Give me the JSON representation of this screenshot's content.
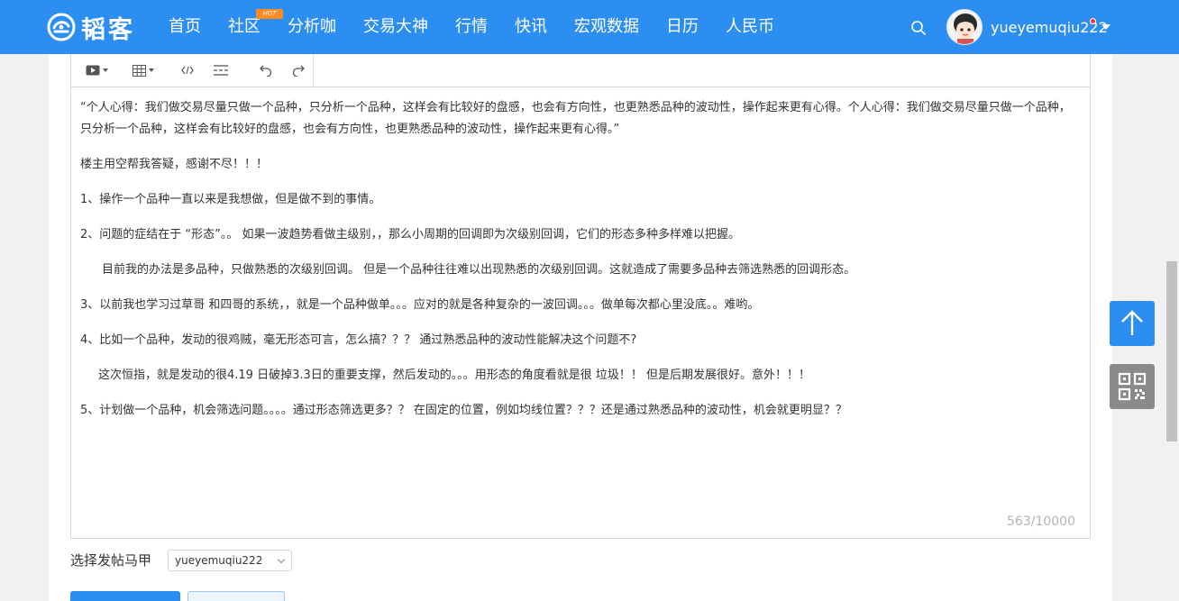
{
  "brand": {
    "name": "韬客"
  },
  "nav": {
    "items": [
      "首页",
      "社区",
      "分析咖",
      "交易大神",
      "行情",
      "快讯",
      "宏观数据",
      "日历",
      "人民币"
    ],
    "hot_badge": "HOT"
  },
  "user": {
    "name": "yueyemuqiu222"
  },
  "icons": {
    "search": "search-icon",
    "caret": "caret-down-icon",
    "back_to_top": "arrow-up-icon",
    "qr": "qr-code-icon"
  },
  "colors": {
    "accent": "#2b8ef0",
    "hot": "#ff8a1f",
    "counter": "#b4b4b4"
  },
  "editor": {
    "toolbar": [
      "video-icon",
      "table-icon",
      "code-icon",
      "divider-icon",
      "undo-icon",
      "redo-icon"
    ],
    "paragraphs": [
      "“个人心得：我们做交易尽量只做一个品种，只分析一个品种，这样会有比较好的盘感，也会有方向性，也更熟悉品种的波动性，操作起来更有心得。个人心得：我们做交易尽量只做一个品种，只分析一个品种，这样会有比较好的盘感，也会有方向性，也更熟悉品种的波动性，操作起来更有心得。”",
      "楼主用空帮我答疑，感谢不尽！！！",
      "1、操作一个品种一直以来是我想做，但是做不到的事情。",
      "2、问题的症结在于 “形态”。。  如果一波趋势看做主级别，，那么小周期的回调即为次级别回调，它们的形态多种多样难以把握。",
      "目前我的办法是多品种，只做熟悉的次级别回调。 但是一个品种往往难以出现熟悉的次级别回调。这就造成了需要多品种去筛选熟悉的回调形态。",
      "3、以前我也学习过草哥 和四哥的系统，，就是一个品种做单。。。应对的就是各种复杂的一波回调。。。做单每次都心里没底。。难哟。",
      "4、比如一个品种，发动的很鸡贼，毫无形态可言，怎么搞？？？   通过熟悉品种的波动性能解决这个问题不?",
      "这次恒指，就是发动的很4.19 日破掉3.3日的重要支撑，然后发动的。。。用形态的角度看就是很  垃圾！！   但是后期发展很好。意外！！！",
      "5、计划做一个品种，机会筛选问题。。。。通过形态筛选更多？？  在固定的位置，例如均线位置？？？还是通过熟悉品种的波动性，机会就更明显？？"
    ],
    "counter": "563/10000"
  },
  "form": {
    "vest_label": "选择发帖马甲",
    "vest_value": "yueyemuqiu222"
  }
}
